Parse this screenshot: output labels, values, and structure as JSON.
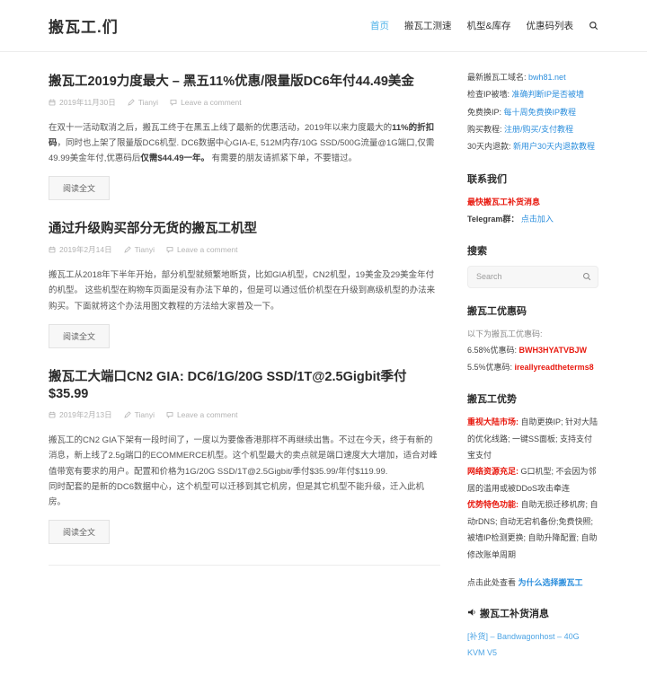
{
  "site": {
    "title": "搬瓦工.们"
  },
  "nav": {
    "items": [
      {
        "label": "首页",
        "active": true
      },
      {
        "label": "搬瓦工测速",
        "active": false
      },
      {
        "label": "机型&库存",
        "active": false
      },
      {
        "label": "优惠码列表",
        "active": false
      }
    ]
  },
  "posts": [
    {
      "title": "搬瓦工2019力度最大 – 黑五11%优惠/限量版DC6年付44.49美金",
      "date": "2019年11月30日",
      "author": "Tianyi",
      "comments": "Leave a comment",
      "read_more": "阅读全文",
      "body": {
        "run1": "在双十一活动取消之后，搬瓦工终于在黑五上线了最新的优惠活动，2019年以来力度最大的",
        "bold1": "11%的折扣码",
        "run2": "，同时也上架了限量版DC6机型. DC6数据中心GIA-E, 512M内存/10G SSD/500G流量@1G端口,仅需49.99美金年付,优惠码后",
        "bold2": "仅需$44.49一年。",
        "run3": " 有需要的朋友请抓紧下单，不要错过。"
      }
    },
    {
      "title": "通过升级购买部分无货的搬瓦工机型",
      "date": "2019年2月14日",
      "author": "Tianyi",
      "comments": "Leave a comment",
      "read_more": "阅读全文",
      "body": {
        "p1": "搬瓦工从2018年下半年开始，部分机型就频繁地断货，比如GIA机型，CN2机型，19美金及29美金年付的机型。 这些机型在购物车页面是没有办法下单的，但是可以通过低价机型在升级到高级机型的办法来购买。下面就将这个办法用图文教程的方法给大家普及一下。"
      }
    },
    {
      "title": "搬瓦工大端口CN2 GIA: DC6/1G/20G SSD/1T@2.5Gigbit季付$35.99",
      "date": "2019年2月13日",
      "author": "Tianyi",
      "comments": "Leave a comment",
      "read_more": "阅读全文",
      "body": {
        "p1": "搬瓦工的CN2 GIA下架有一段时间了，一度以为要像香港那样不再继续出售。不过在今天，终于有新的消息，新上线了2.5g端口的ECOMMERCE机型。这个机型最大的卖点就是端口速度大大增加，适合对峰值带宽有要求的用户。配置和价格为1G/20G SSD/1T@2.5Gigbit/季付$35.99/年付$119.99.",
        "p2": "同时配套的是新的DC6数据中心，这个机型可以迁移到其它机房，但是其它机型不能升级，迁入此机房。"
      }
    }
  ],
  "sidebar": {
    "quick_links": [
      {
        "label": "最新搬瓦工域名:",
        "link": "bwh81.net"
      },
      {
        "label": "检查IP被墙:",
        "link": "准确判断IP是否被墙"
      },
      {
        "label": "免费换IP:",
        "link": "每十周免费换IP教程"
      },
      {
        "label": "购买教程:",
        "link": "注册/购买/支付教程"
      },
      {
        "label": "30天内退款:",
        "link": "新用户30天内退款教程"
      }
    ],
    "contact": {
      "heading": "联系我们",
      "alert": "最快搬瓦工补货消息",
      "telegram_label": "Telegram群：",
      "telegram_link": "点击加入"
    },
    "search": {
      "heading": "搜索",
      "placeholder": "Search"
    },
    "coupons": {
      "heading": "搬瓦工优惠码",
      "intro": "以下为搬瓦工优惠码:",
      "items": [
        {
          "label": "6.58%优惠码:",
          "code": "BWH3HYATVBJW"
        },
        {
          "label": "5.5%优惠码:",
          "code": "ireallyreadtheterms8"
        }
      ]
    },
    "advantages": {
      "heading": "搬瓦工优势",
      "items": [
        {
          "lead": "重视大陆市场:",
          "text": " 自助更换IP; 针对大陆的优化线路; 一键SS面板; 支持支付宝支付"
        },
        {
          "lead": "网络资源充足:",
          "text": " G口机型; 不会因为邻居的滥用或被DDoS攻击牵连"
        },
        {
          "lead": "优势特色功能:",
          "text": " 自助无损迁移机房; 自动rDNS; 自动无宕机备份;免费快照; 被墙IP检测更换; 自助升降配置; 自助修改账单周期"
        }
      ],
      "more_prefix": "点击此处查看 ",
      "more_link": "为什么选择搬瓦工"
    },
    "restock": {
      "heading": "搬瓦工补货消息",
      "items": [
        {
          "label": "[补货] – Bandwagonhost – 40G KVM V5"
        }
      ]
    }
  },
  "colors": {
    "nav_active_blue": "#4db2e8",
    "link_blue": "#2d8fdd",
    "alert_red": "#e8190f"
  }
}
